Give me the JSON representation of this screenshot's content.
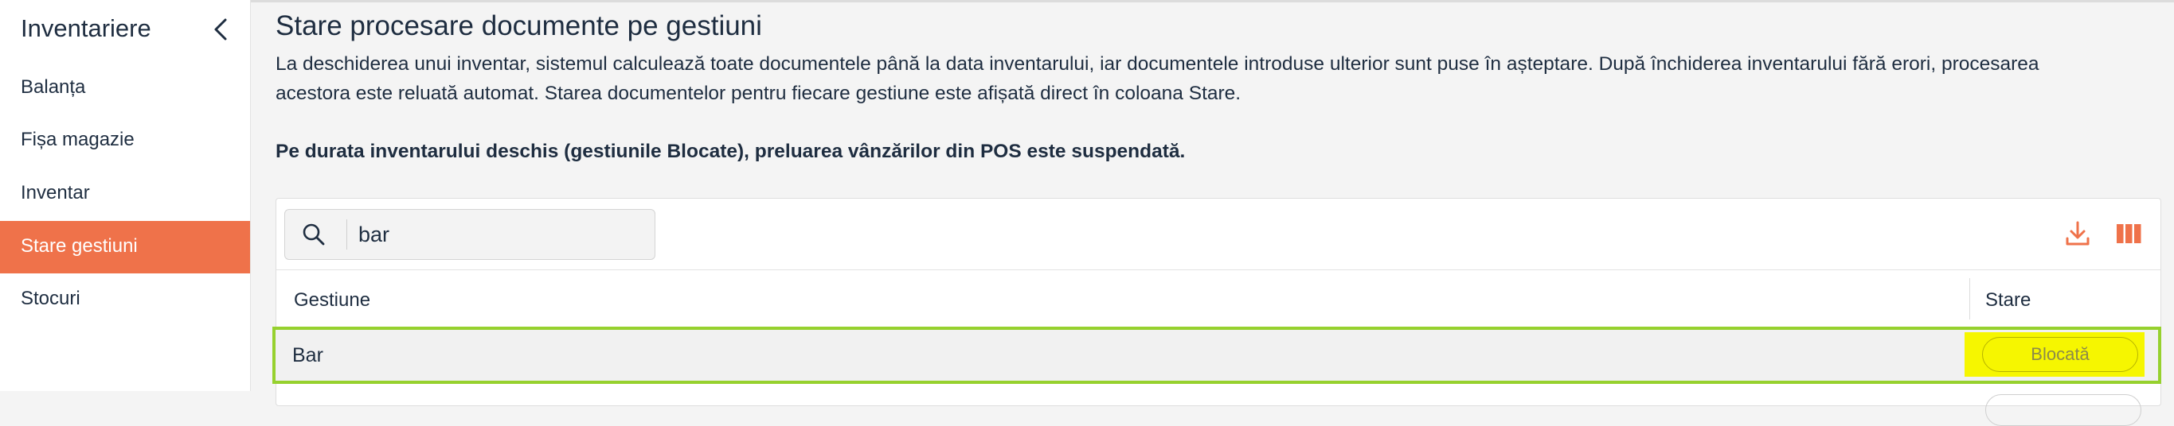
{
  "sidebar": {
    "title": "Inventariere",
    "items": [
      {
        "label": "Balanța",
        "active": false
      },
      {
        "label": "Fișa magazie",
        "active": false
      },
      {
        "label": "Inventar",
        "active": false
      },
      {
        "label": "Stare gestiuni",
        "active": true
      },
      {
        "label": "Stocuri",
        "active": false
      }
    ]
  },
  "main": {
    "title": "Stare procesare documente pe gestiuni",
    "description": "La deschiderea unui inventar, sistemul calculează toate documentele până la data inventarului, iar documentele introduse ulterior sunt puse în așteptare. După închiderea inventarului fără erori, procesarea\nacestora este reluată automat. Starea documentelor pentru fiecare gestiune este afișată direct în coloana Stare.",
    "warning": "Pe durata inventarului deschis (gestiunile Blocate), preluarea vânzărilor din POS este suspendată."
  },
  "table": {
    "search": {
      "value": "bar"
    },
    "columns": [
      "Gestiune",
      "Stare"
    ],
    "rows": [
      {
        "gestiune": "Bar",
        "stare": "Blocată"
      }
    ]
  },
  "icons": {
    "search": "search-icon",
    "download": "download-icon",
    "columns": "columns-icon",
    "back": "chevron-left-icon"
  },
  "colors": {
    "accent": "#ef724a",
    "highlight_border": "#96d12e",
    "highlight_fill": "#f6f600"
  }
}
